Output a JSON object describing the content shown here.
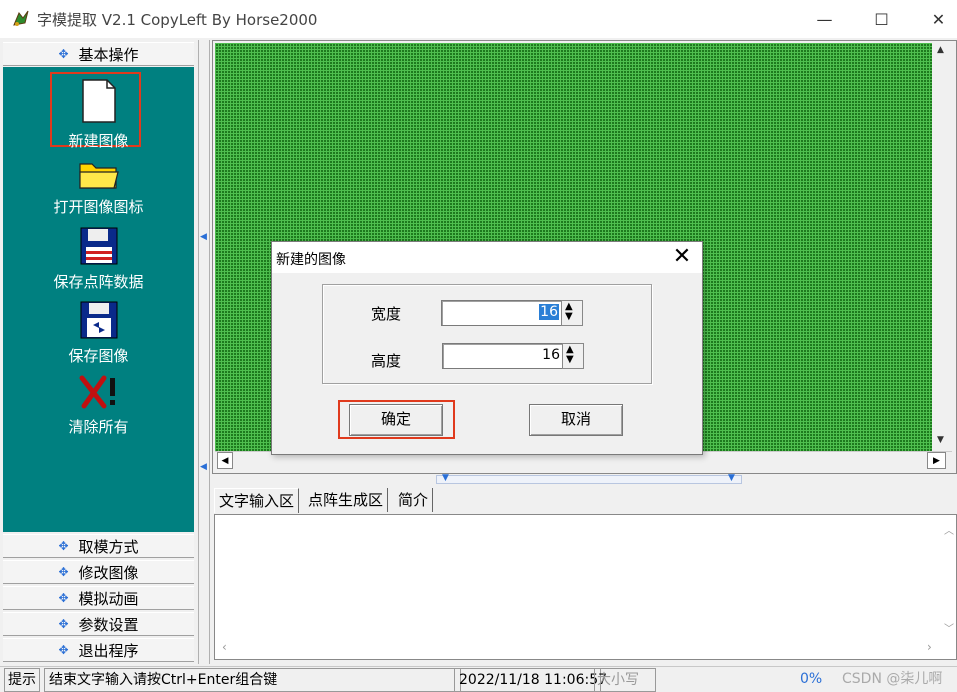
{
  "window": {
    "title": "字模提取 V2.1  CopyLeft By Horse2000",
    "min_label": "—",
    "max_label": "☐",
    "close_label": "✕"
  },
  "sidebar": {
    "top_section": "基本操作",
    "tools": [
      {
        "label": "新建图像",
        "icon": "new-document-icon"
      },
      {
        "label": "打开图像图标",
        "icon": "folder-icon"
      },
      {
        "label": "保存点阵数据",
        "icon": "floppy-disk-icon"
      },
      {
        "label": "保存图像",
        "icon": "save-image-icon"
      },
      {
        "label": "清除所有",
        "icon": "clear-x-icon"
      }
    ],
    "sections": [
      "取模方式",
      "修改图像",
      "模拟动画",
      "参数设置",
      "退出程序"
    ],
    "section_marker": "✥"
  },
  "tabs": [
    {
      "label": "文字输入区"
    },
    {
      "label": "点阵生成区"
    },
    {
      "label": "简介"
    }
  ],
  "statusbar": {
    "hint": "提示",
    "message": "结束文字输入请按Ctrl+Enter组合键",
    "datetime": "2022/11/18 11:06:57",
    "caps": "大小写",
    "percent": "0%",
    "watermark": "CSDN @柒儿啊"
  },
  "dialog": {
    "title": "新建的图像",
    "close_label": "✕",
    "width_label": "宽度",
    "width_value": "16",
    "height_label": "高度",
    "height_value": "16",
    "ok_label": "确定",
    "cancel_label": "取消"
  },
  "colors": {
    "sidebar_panel": "#008080",
    "grid_dark": "#1e7a1e",
    "grid_light": "#4fbf4f",
    "highlight": "#e03a1d"
  }
}
